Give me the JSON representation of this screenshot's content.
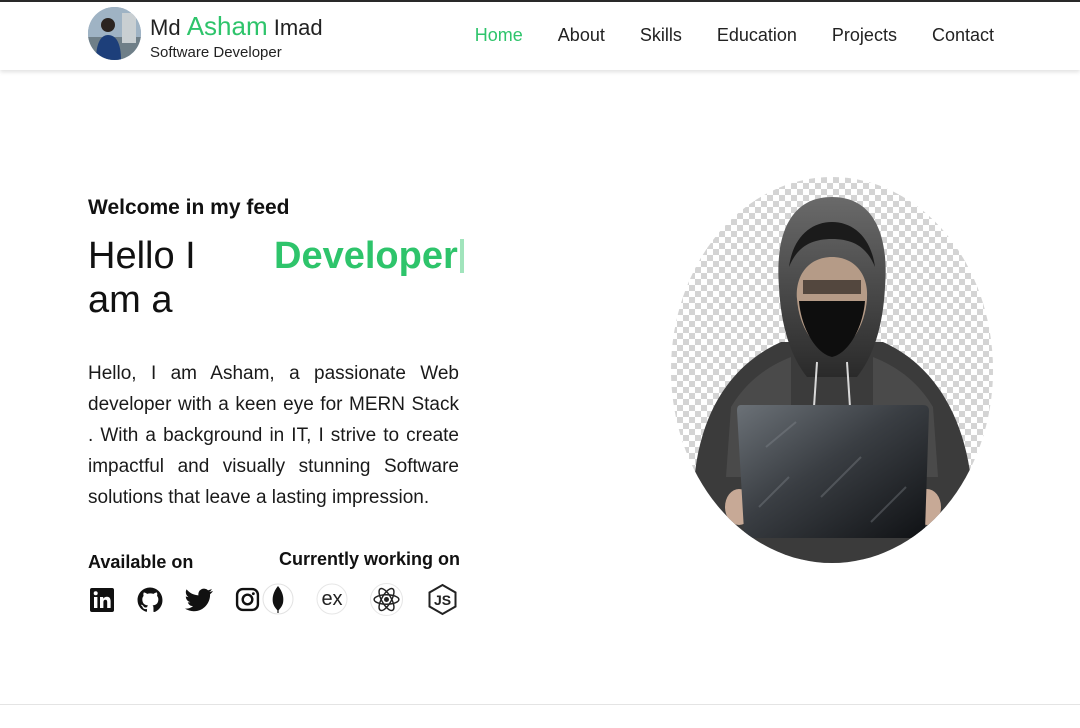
{
  "colors": {
    "accent": "#2ec46b",
    "text": "#111111"
  },
  "brand": {
    "first": "Md",
    "accent": "Asham",
    "last": "Imad",
    "subtitle": "Software Developer"
  },
  "nav": {
    "items": [
      {
        "label": "Home",
        "active": true
      },
      {
        "label": "About"
      },
      {
        "label": "Skills"
      },
      {
        "label": "Education"
      },
      {
        "label": "Projects"
      },
      {
        "label": "Contact"
      }
    ]
  },
  "hero": {
    "welcome": "Welcome in my feed",
    "greeting": "Hello I am a",
    "typed": "Developer",
    "intro": "Hello, I am Asham, a passionate Web developer with a keen eye for MERN Stack . With a background in IT, I strive to create impactful and visually stunning Software solutions that leave a lasting impression.",
    "available_label": "Available on",
    "working_label": "Currently working on"
  },
  "social_icons": [
    "linkedin-icon",
    "github-icon",
    "twitter-icon",
    "instagram-icon"
  ],
  "tech_icons": [
    "mongodb-icon",
    "express-icon",
    "react-icon",
    "nodejs-icon"
  ]
}
